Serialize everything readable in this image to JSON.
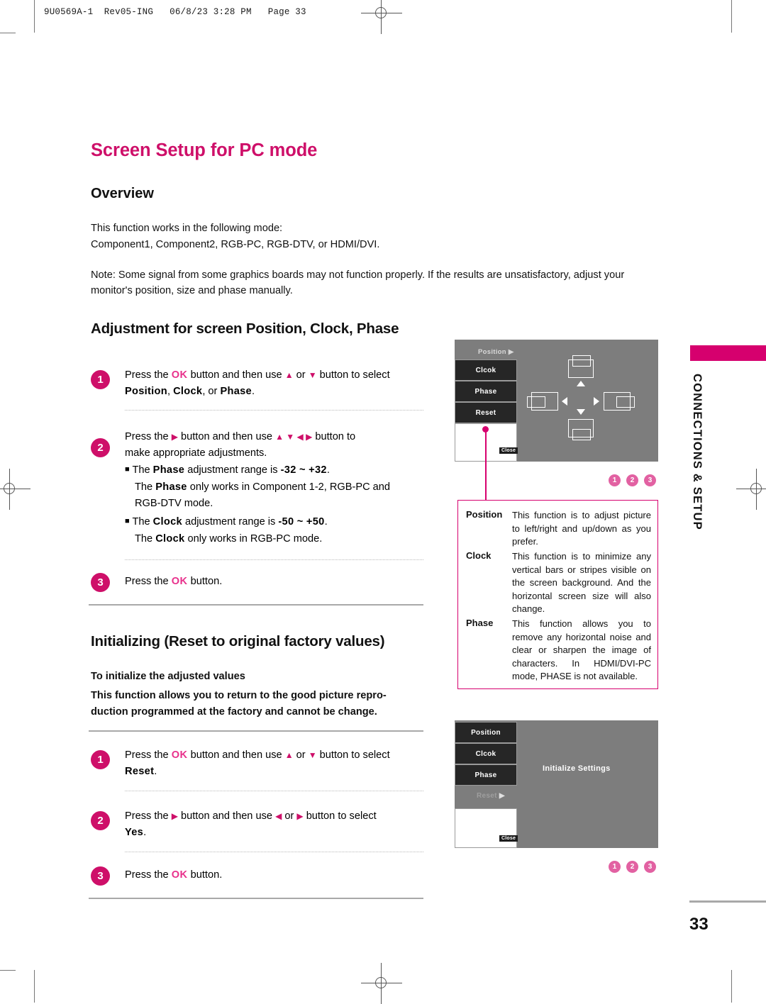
{
  "doc_header": "9U0569A-1  Rev05-ING   06/8/23 3:28 PM   Page 33",
  "title": "Screen Setup for PC mode",
  "overview": {
    "heading": "Overview",
    "line1": "This function works in the following mode:",
    "line2": "Component1, Component2, RGB-PC, RGB-DTV, or HDMI/DVI.",
    "note": "Note: Some signal from some graphics boards may not function properly. If the results are unsatisfactory, adjust your monitor's position, size and phase manually."
  },
  "adjustment": {
    "heading": "Adjustment for screen Position, Clock, Phase",
    "steps": [
      {
        "num": "1",
        "line1_pre": "Press the ",
        "ok": "OK",
        "line1_mid": " button and then use ",
        "arrow_up": "▲",
        "line1_or": " or ",
        "arrow_down": "▼",
        "line1_post": " button to select",
        "line2_bold1": "Position",
        "line2_sep1": ", ",
        "line2_bold2": "Clock",
        "line2_sep2": ", or ",
        "line2_bold3": "Phase",
        "line2_end": "."
      },
      {
        "num": "2",
        "line1_pre": "Press the ",
        "arrow_right": "▶",
        "line1_mid": " button and then use ",
        "arrows": "▲ ▼ ◀ ▶",
        "line1_post": " button to",
        "line2": "make appropriate adjustments.",
        "bullets": [
          {
            "lead": "The ",
            "term": "Phase",
            "mid": " adjustment range is ",
            "range": "-32 ~ +32",
            "end": ".",
            "sub_pre": "The ",
            "sub_term": "Phase",
            "sub_post": " only works in Component 1-2, RGB-PC and",
            "sub_line2": "RGB-DTV mode."
          },
          {
            "lead": "The ",
            "term": "Clock",
            "mid": " adjustment range is ",
            "range": "-50 ~ +50",
            "end": ".",
            "sub_pre": "The ",
            "sub_term": "Clock",
            "sub_post": " only works in RGB-PC mode.",
            "sub_line2": ""
          }
        ]
      },
      {
        "num": "3",
        "line1_pre": "Press the ",
        "ok": "OK",
        "line1_post": " button."
      }
    ]
  },
  "initializing": {
    "heading": "Initializing (Reset to original factory values)",
    "subheading": "To initialize the adjusted values",
    "body": "This function allows you to return to the good picture repro-duction programmed at the factory and cannot be change.",
    "body_line1": "This function allows you to return to the good picture repro-",
    "body_line2": "duction programmed at the factory and cannot be change.",
    "steps": [
      {
        "num": "1",
        "line1_pre": "Press the ",
        "ok": "OK",
        "line1_mid": " button and then use ",
        "arrow_up": "▲",
        "line1_or": " or ",
        "arrow_down": "▼",
        "line1_post": " button to select",
        "line2_bold": "Reset",
        "line2_end": "."
      },
      {
        "num": "2",
        "line1_pre": "Press the ",
        "arrow_right": "▶",
        "line1_mid": " button and then use ",
        "arrow_left": "◀",
        "line1_or": " or ",
        "arrow_right2": "▶",
        "line1_post": " button to select",
        "line2_bold": "Yes",
        "line2_end": "."
      },
      {
        "num": "3",
        "line1_pre": "Press the ",
        "ok": "OK",
        "line1_post": " button."
      }
    ]
  },
  "osd_top": {
    "header_label": "Position",
    "header_arrow": "▶",
    "items": [
      "Clcok",
      "Phase",
      "Reset"
    ],
    "close_label": "Close"
  },
  "osd_bottom": {
    "items": [
      "Position",
      "Clcok",
      "Phase"
    ],
    "reset_label": "Reset",
    "reset_arrow": "▶",
    "initialize_label": "Initialize Settings",
    "close_label": "Close"
  },
  "step_markers_top": [
    "1",
    "2",
    "3"
  ],
  "step_markers_bottom": [
    "1",
    "2",
    "3"
  ],
  "descriptions": [
    {
      "term": "Position",
      "text": "This function is to adjust picture to left/right and up/down as you prefer."
    },
    {
      "term": "Clock",
      "text": "This function is to minimize any vertical bars or stripes visible on the screen background. And the horizontal screen size will also change."
    },
    {
      "term": "Phase",
      "text": "This function allows you to remove any horizontal noise and clear or sharpen the image of characters. In HDMI/DVI-PC mode, PHASE is not available."
    }
  ],
  "side_tab": "CONNECTIONS & SETUP",
  "page_number": "33",
  "colors": {
    "magenta": "#CE0F69",
    "pink_accent": "#E8318C",
    "mini_circle": "#E261A2",
    "osd_gray": "#7d7d7d",
    "osd_item": "#262626",
    "rule_gray": "#a9a9a9"
  }
}
